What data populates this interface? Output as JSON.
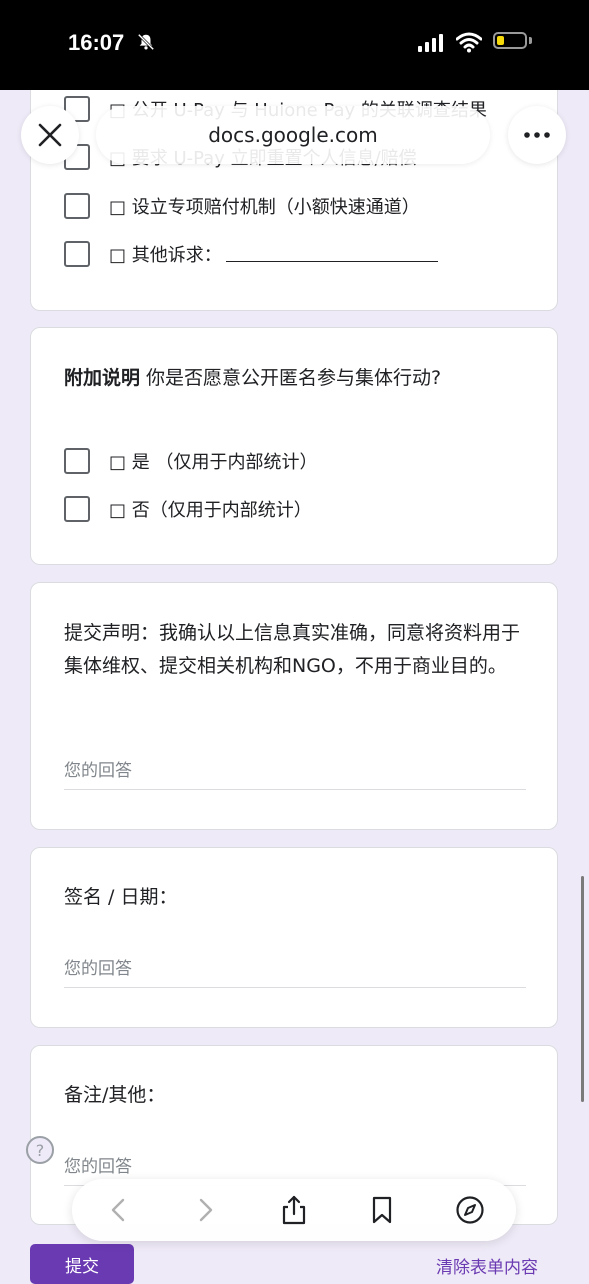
{
  "status_bar": {
    "time": "16:07"
  },
  "browser": {
    "url": "docs.google.com"
  },
  "card1": {
    "options": [
      "□ 公开 U-Pay 与 Huione Pay 的关联调查结果",
      "□ 要求 U-Pay 立即重置个人信息/赔偿",
      "□ 设立专项赔付机制（小额快速通道）",
      "□ 其他诉求："
    ]
  },
  "card2": {
    "title_bold": "附加说明",
    "title_text": " 你是否愿意公开匿名参与集体行动?",
    "options": [
      "□ 是 （仅用于内部统计）",
      "□ 否（仅用于内部统计）"
    ]
  },
  "card3": {
    "question": "提交声明：我确认以上信息真实准确，同意将资料用于集体维权、提交相关机构和NGO，不用于商业目的。",
    "placeholder": "您的回答"
  },
  "card4": {
    "question": "签名 / 日期：",
    "placeholder": "您的回答"
  },
  "card5": {
    "question": "备注/其他：",
    "placeholder": "您的回答"
  },
  "footer": {
    "submit_label": "提交",
    "clear_label": "清除表单内容"
  },
  "help": {
    "glyph": "?"
  }
}
